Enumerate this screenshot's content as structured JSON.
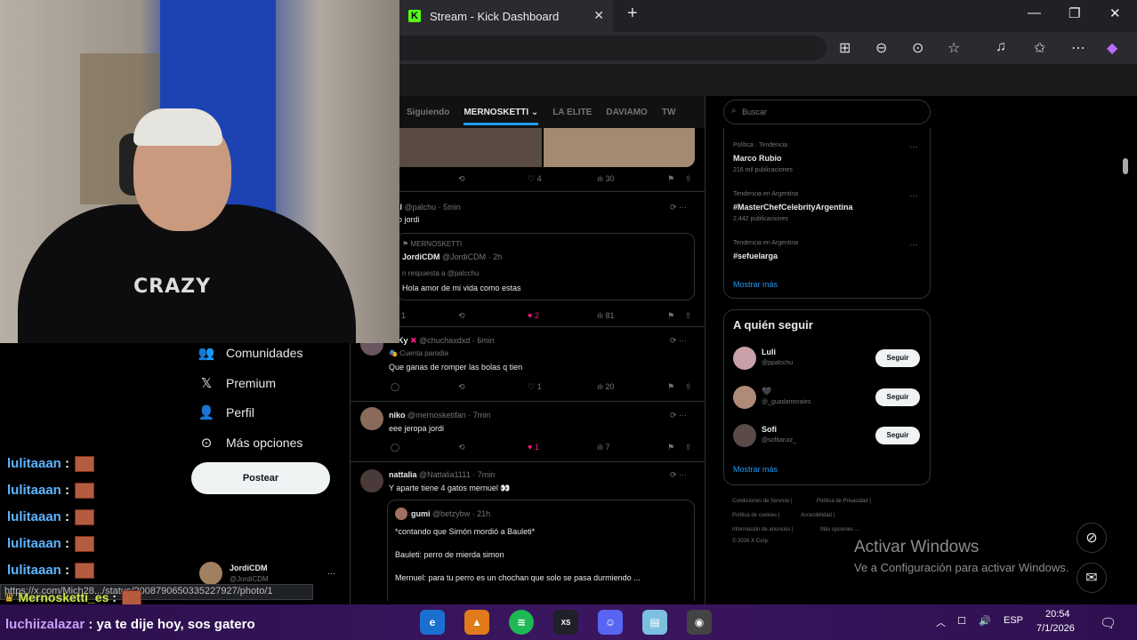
{
  "browser": {
    "tab_title": "Stream - Kick Dashboard",
    "tab_close": "✕",
    "new_tab": "+",
    "window_controls": [
      "—",
      "❐",
      "✕"
    ]
  },
  "x_tabs": [
    "Siguiendo",
    "MERNOSKETTI ⌄",
    "LA ELITE",
    "DAVIAMO",
    "TW"
  ],
  "feed": {
    "post0": {
      "actions": {
        "reply": "",
        "repost": "",
        "like": "4",
        "views": "30"
      }
    },
    "post1": {
      "author": "ll",
      "handle": "@palchu · 5min",
      "text": "o jordi",
      "quote": {
        "community": "MERNOSKETTI",
        "author": "JordiCDM",
        "handle": "@JordiCDM · 2h",
        "reply_to": "n respuesta a @palcchu",
        "text": "Hola amor de mi vida como estas"
      },
      "actions": {
        "reply": "1",
        "repost": "",
        "like": "2",
        "views": "81"
      }
    },
    "post2": {
      "author": "Ky",
      "handle": "@chuchaxdxd · 6min",
      "badge": "Cuenta parodia",
      "text": "Que ganas de romper las bolas q tien",
      "actions": {
        "reply": "",
        "repost": "",
        "like": "1",
        "views": "20"
      }
    },
    "post3": {
      "author": "niko",
      "handle": "@mernosketifan · 7min",
      "text": "eee jeropa jordi",
      "actions": {
        "reply": "",
        "repost": "",
        "like": "1",
        "views": "7"
      }
    },
    "post4": {
      "author": "nattalia",
      "handle": "@Nattalia1111 · 7min",
      "text": "Y aparte tiene 4 gatos mernuel 👀",
      "quote": {
        "author": "gumi",
        "handle": "@betzybw · 21h",
        "line1": "*contando que Simón mordió a Bauleti*",
        "line2": "Bauleti: perro de mierda simon",
        "line3": "Mernuel: para tu perro es un chochan que solo se pasa durmiendo ..."
      }
    }
  },
  "sidebar": {
    "search_placeholder": "Buscar",
    "trends": [
      {
        "meta": "Política · Tendencia",
        "title": "Marco Rubio",
        "count": "216 mil publicaciones"
      },
      {
        "meta": "Tendencia en Argentina",
        "title": "#MasterChefCelebrityArgentina",
        "count": "2.442 publicaciones"
      },
      {
        "meta": "Tendencia en Argentina",
        "title": "#sefuelarga",
        "count": ""
      }
    ],
    "show_more": "Mostrar más",
    "who_to_follow_title": "A quién seguir",
    "follow": [
      {
        "name": "Luli",
        "handle": "@ppalcchu",
        "button": "Seguir"
      },
      {
        "name": "🖤",
        "handle": "@_guadamoraies",
        "button": "Seguir"
      },
      {
        "name": "Sofi",
        "handle": "@sofitaruiz_",
        "button": "Seguir"
      }
    ],
    "show_more2": "Mostrar más",
    "footer": [
      "Condiciones de Servicio |",
      "Política de Privacidad |",
      "Política de cookies |",
      "Accesibilidad |",
      "Información de anuncios |",
      "Más opciones ...",
      "© 2026 X Corp."
    ]
  },
  "left_nav": {
    "items": [
      {
        "icon": "👥",
        "label": "Comunidades"
      },
      {
        "icon": "𝕏",
        "label": "Premium"
      },
      {
        "icon": "👤",
        "label": "Perfil"
      },
      {
        "icon": "⊙",
        "label": "Más opciones"
      }
    ],
    "post_button": "Postear",
    "account_name": "JordiCDM",
    "account_handle": "@JordiCDM",
    "account_more": "···"
  },
  "chat": {
    "lines": [
      {
        "user": "lulitaaan",
        "sep": " :"
      },
      {
        "user": "lulitaaan",
        "sep": " :"
      },
      {
        "user": "lulitaaan",
        "sep": " :"
      },
      {
        "user": "lulitaaan",
        "sep": " :"
      },
      {
        "user": "lulitaaan",
        "sep": " :"
      }
    ],
    "url_status": "https://x.com/Mich28.../status/2008790650335227927/photo/1",
    "line6_user": "Mernosketti_es",
    "line6_sep": " :",
    "line7_user": "luchiizalazar",
    "line7_text": " : ya te dije hoy, sos gatero"
  },
  "watermark": {
    "title": "Activar Windows",
    "subtitle": "Ve a Configuración para activar Windows."
  },
  "taskbar": {
    "language": "ESP",
    "time": "20:54",
    "date": "7/1/2026"
  },
  "colors": {
    "accent": "#1d9bf0",
    "like": "#f91880",
    "kick": "#53fc18"
  }
}
